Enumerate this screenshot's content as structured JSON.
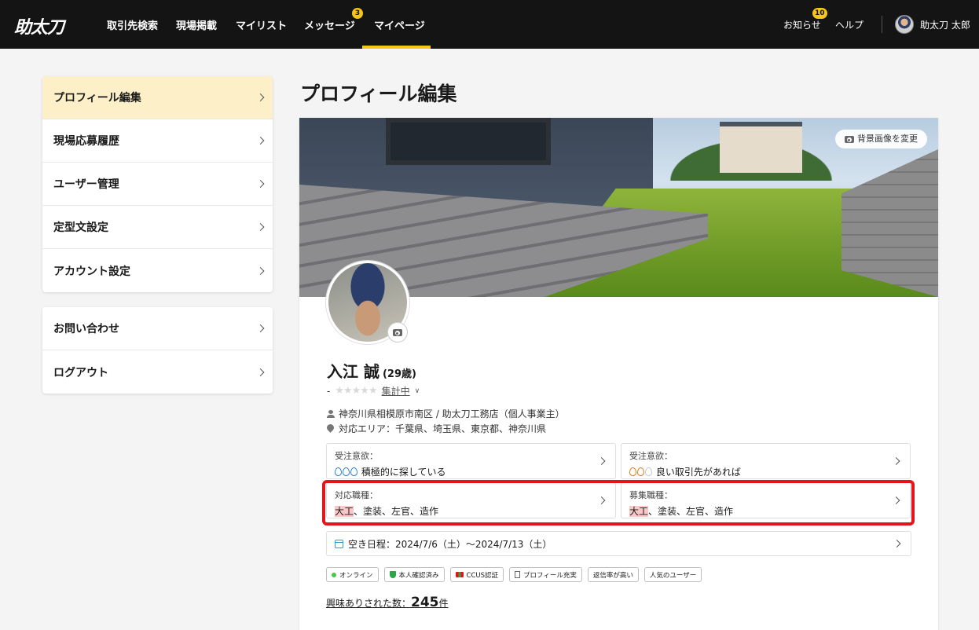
{
  "header": {
    "logo": "助太刀",
    "nav": [
      {
        "label": "取引先検索"
      },
      {
        "label": "現場掲載"
      },
      {
        "label": "マイリスト"
      },
      {
        "label": "メッセージ",
        "badge": "3"
      },
      {
        "label": "マイページ",
        "active": true
      }
    ],
    "notifications_label": "お知らせ",
    "notifications_badge": "10",
    "help_label": "ヘルプ",
    "user_name": "助太刀 太郎"
  },
  "sidebar": {
    "group1": [
      {
        "label": "プロフィール編集",
        "active": true
      },
      {
        "label": "現場応募履歴"
      },
      {
        "label": "ユーザー管理"
      },
      {
        "label": "定型文設定"
      },
      {
        "label": "アカウント設定"
      }
    ],
    "group2": [
      {
        "label": "お問い合わせ"
      },
      {
        "label": "ログアウト"
      }
    ]
  },
  "main": {
    "title": "プロフィール編集",
    "change_bg_label": "背景画像を変更",
    "profile": {
      "name": "入江 誠",
      "age": "(29歳)",
      "rating_prefix": "-",
      "rating_status": "集計中",
      "rating_stars": 0,
      "company": "神奈川県相模原市南区 / 助太刀工務店（個人事業主）",
      "area": "対応エリア：千葉県、埼玉県、東京都、神奈川県"
    },
    "boxes": {
      "order_will": {
        "label": "受注意欲：",
        "value": "積極的に探している",
        "level": 3
      },
      "recruit_will": {
        "label": "受注意欲：",
        "value": "良い取引先があれば",
        "level": 2
      },
      "job_types": {
        "label": "対応職種：",
        "highlight": "大工",
        "rest": "、塗装、左官、造作"
      },
      "recruit_types": {
        "label": "募集職種：",
        "highlight": "大工",
        "rest": "、塗装、左官、造作"
      }
    },
    "schedule": "空き日程：2024/7/6（土）〜2024/7/13（土）",
    "tags": [
      "オンライン",
      "本人確認済み",
      "CCUS認証",
      "プロフィール充実",
      "返信率が高い",
      "人気のユーザー"
    ],
    "interest": {
      "label": "興味ありされた数：",
      "count": "245",
      "unit": "件"
    }
  },
  "colors": {
    "nav_bg": "#141414",
    "accent": "#f5c518",
    "active_sidebar_bg": "#fdefc7",
    "highlight_frame": "#e5141a",
    "highlight_text_bg": "#f9c7c7"
  }
}
